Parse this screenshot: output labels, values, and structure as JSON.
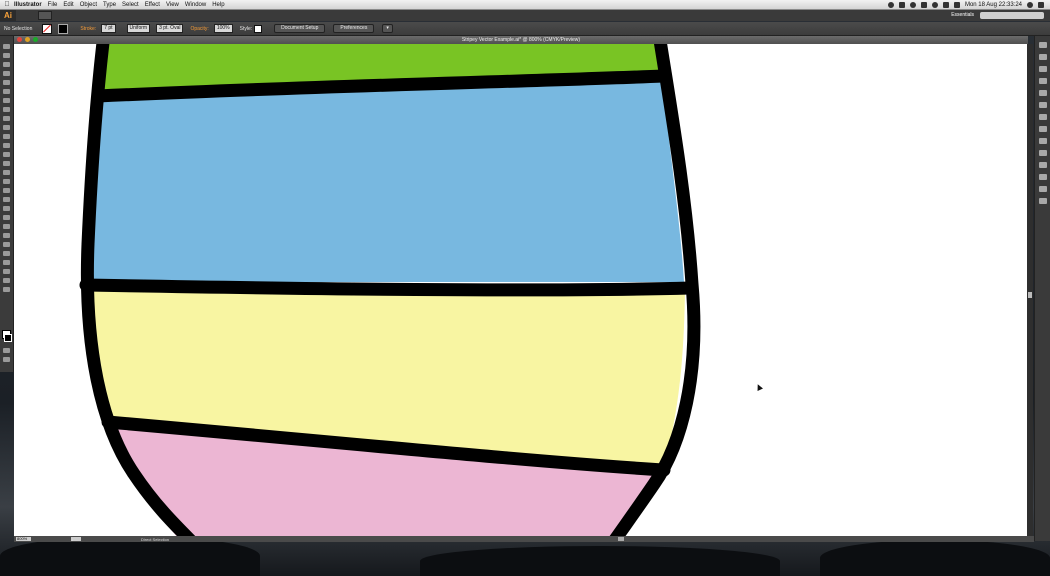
{
  "menubar": {
    "app_name": "Illustrator",
    "items": [
      "File",
      "Edit",
      "Object",
      "Type",
      "Select",
      "Effect",
      "View",
      "Window",
      "Help"
    ],
    "clock": "Mon 18 Aug  22:33:24"
  },
  "appbar": {
    "logo": "Ai",
    "workspace": "Essentials"
  },
  "controlbar": {
    "selection_label": "No Selection",
    "stroke_label": "Stroke:",
    "stroke_weight": "7 pt",
    "stroke_style": "Uniform",
    "brush": "3 pt. Oval",
    "opacity_label": "Opacity:",
    "opacity_value": "100%",
    "style_label": "Style:",
    "document_setup": "Document Setup",
    "preferences": "Preferences"
  },
  "document": {
    "tab_title": "Stripey Vector Example.ai* @ 800% (CMYK/Preview)"
  },
  "statusbar": {
    "zoom": "800%",
    "artboard": "1",
    "tool": "Direct Selection"
  },
  "artwork": {
    "outline_color": "#000000",
    "stripes": [
      {
        "name": "green",
        "color": "#79c424"
      },
      {
        "name": "blue",
        "color": "#78b8e0"
      },
      {
        "name": "yellow",
        "color": "#f8f5a2"
      },
      {
        "name": "pink",
        "color": "#ecb6d3"
      }
    ]
  }
}
